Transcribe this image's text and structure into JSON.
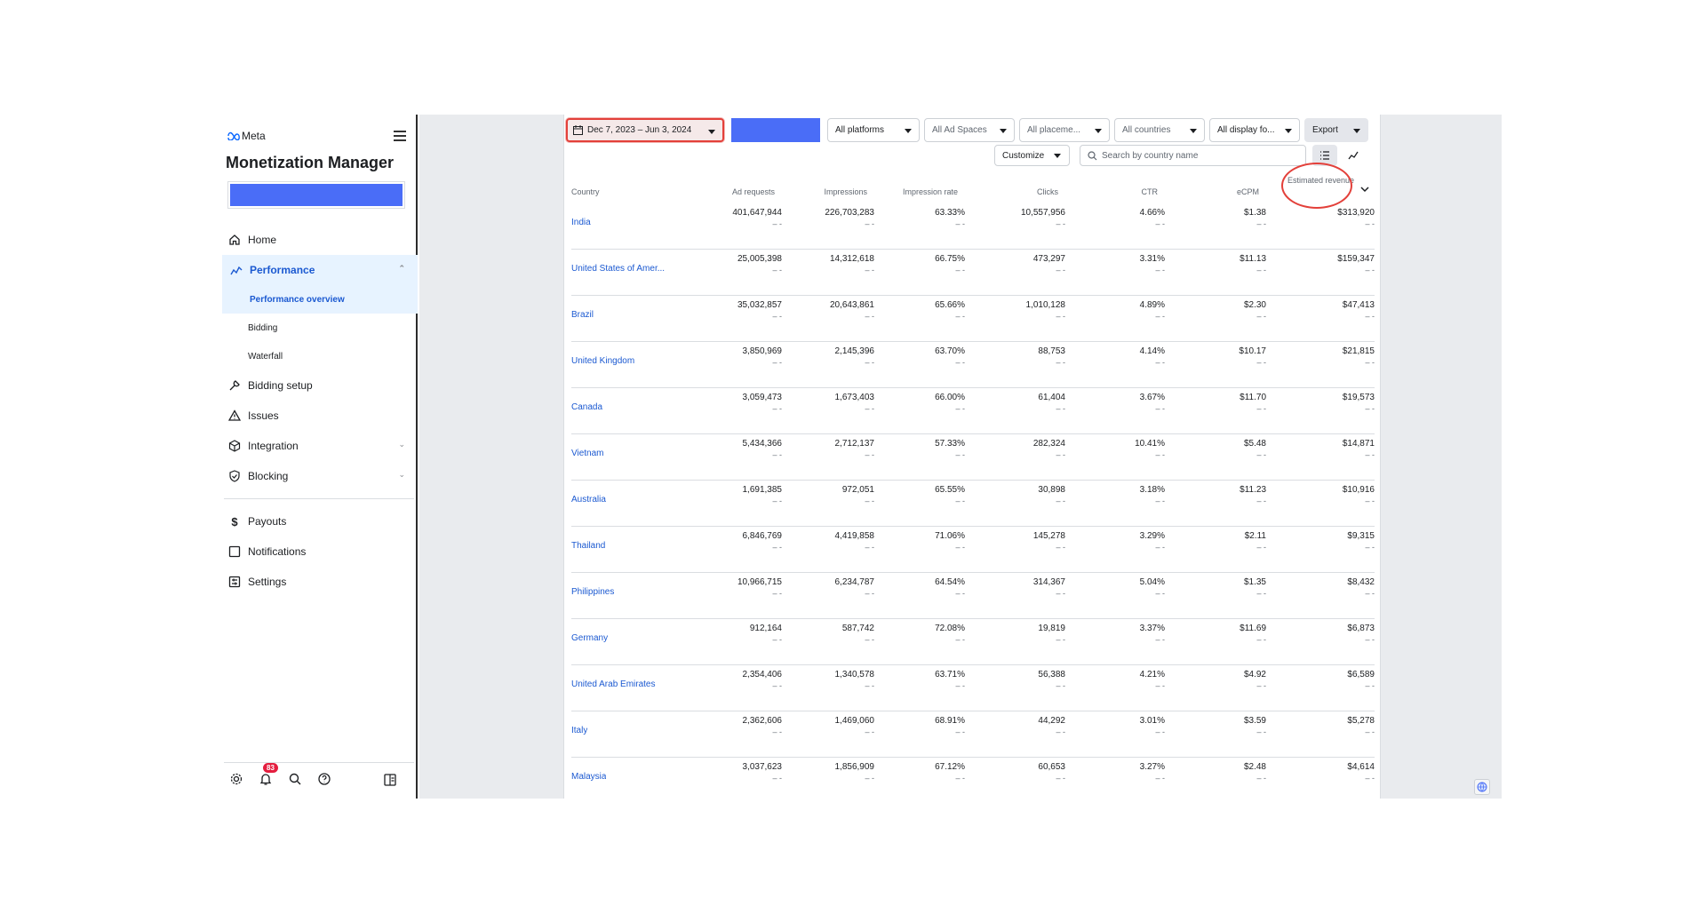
{
  "brand": {
    "logo_text": "Meta",
    "app_title": "Monetization Manager"
  },
  "sidebar": {
    "items": [
      {
        "label": "Home",
        "icon": "home-icon"
      },
      {
        "label": "Performance",
        "icon": "performance-icon",
        "active": true
      },
      {
        "label": "Bidding setup",
        "icon": "wrench-icon"
      },
      {
        "label": "Issues",
        "icon": "warning-icon"
      },
      {
        "label": "Integration",
        "icon": "cube-icon"
      },
      {
        "label": "Blocking",
        "icon": "shield-icon"
      },
      {
        "label": "Payouts",
        "icon": "dollar-icon"
      },
      {
        "label": "Notifications",
        "icon": "notification-icon"
      },
      {
        "label": "Settings",
        "icon": "settings-icon"
      }
    ],
    "performance_sub": [
      "Performance overview",
      "Bidding",
      "Waterfall"
    ],
    "notification_count": "83"
  },
  "toolbar": {
    "date_range": "Dec 7, 2023 – Jun 3, 2024",
    "platforms": "All platforms",
    "ad_spaces": "All Ad Spaces",
    "placements": "All placeme...",
    "countries": "All countries",
    "display_formats": "All display fo...",
    "export": "Export",
    "customize": "Customize",
    "search_placeholder": "Search by country name"
  },
  "table": {
    "headers": {
      "country": "Country",
      "ad_requests": "Ad requests",
      "impressions": "Impressions",
      "impression_rate": "Impression rate",
      "clicks": "Clicks",
      "ctr": "CTR",
      "ecpm": "eCPM",
      "estimated_revenue": "Estimated revenue"
    },
    "rows": [
      {
        "country": "India",
        "ad_requests": "401,647,944",
        "impressions": "226,703,283",
        "impression_rate": "63.33%",
        "clicks": "10,557,956",
        "ctr": "4.66%",
        "ecpm": "$1.38",
        "revenue": "$313,920"
      },
      {
        "country": "United States of Amer...",
        "ad_requests": "25,005,398",
        "impressions": "14,312,618",
        "impression_rate": "66.75%",
        "clicks": "473,297",
        "ctr": "3.31%",
        "ecpm": "$11.13",
        "revenue": "$159,347"
      },
      {
        "country": "Brazil",
        "ad_requests": "35,032,857",
        "impressions": "20,643,861",
        "impression_rate": "65.66%",
        "clicks": "1,010,128",
        "ctr": "4.89%",
        "ecpm": "$2.30",
        "revenue": "$47,413"
      },
      {
        "country": "United Kingdom",
        "ad_requests": "3,850,969",
        "impressions": "2,145,396",
        "impression_rate": "63.70%",
        "clicks": "88,753",
        "ctr": "4.14%",
        "ecpm": "$10.17",
        "revenue": "$21,815"
      },
      {
        "country": "Canada",
        "ad_requests": "3,059,473",
        "impressions": "1,673,403",
        "impression_rate": "66.00%",
        "clicks": "61,404",
        "ctr": "3.67%",
        "ecpm": "$11.70",
        "revenue": "$19,573"
      },
      {
        "country": "Vietnam",
        "ad_requests": "5,434,366",
        "impressions": "2,712,137",
        "impression_rate": "57.33%",
        "clicks": "282,324",
        "ctr": "10.41%",
        "ecpm": "$5.48",
        "revenue": "$14,871"
      },
      {
        "country": "Australia",
        "ad_requests": "1,691,385",
        "impressions": "972,051",
        "impression_rate": "65.55%",
        "clicks": "30,898",
        "ctr": "3.18%",
        "ecpm": "$11.23",
        "revenue": "$10,916"
      },
      {
        "country": "Thailand",
        "ad_requests": "6,846,769",
        "impressions": "4,419,858",
        "impression_rate": "71.06%",
        "clicks": "145,278",
        "ctr": "3.29%",
        "ecpm": "$2.11",
        "revenue": "$9,315"
      },
      {
        "country": "Philippines",
        "ad_requests": "10,966,715",
        "impressions": "6,234,787",
        "impression_rate": "64.54%",
        "clicks": "314,367",
        "ctr": "5.04%",
        "ecpm": "$1.35",
        "revenue": "$8,432"
      },
      {
        "country": "Germany",
        "ad_requests": "912,164",
        "impressions": "587,742",
        "impression_rate": "72.08%",
        "clicks": "19,819",
        "ctr": "3.37%",
        "ecpm": "$11.69",
        "revenue": "$6,873"
      },
      {
        "country": "United Arab Emirates",
        "ad_requests": "2,354,406",
        "impressions": "1,340,578",
        "impression_rate": "63.71%",
        "clicks": "56,388",
        "ctr": "4.21%",
        "ecpm": "$4.92",
        "revenue": "$6,589"
      },
      {
        "country": "Italy",
        "ad_requests": "2,362,606",
        "impressions": "1,469,060",
        "impression_rate": "68.91%",
        "clicks": "44,292",
        "ctr": "3.01%",
        "ecpm": "$3.59",
        "revenue": "$5,278"
      },
      {
        "country": "Malaysia",
        "ad_requests": "3,037,623",
        "impressions": "1,856,909",
        "impression_rate": "67.12%",
        "clicks": "60,653",
        "ctr": "3.27%",
        "ecpm": "$2.48",
        "revenue": "$4,614"
      }
    ],
    "comparison_placeholder": "– -"
  },
  "colors": {
    "accent": "#1b59d1",
    "highlight": "#e3403a",
    "redacted": "#4a6df7",
    "badge": "#e41e3f"
  }
}
